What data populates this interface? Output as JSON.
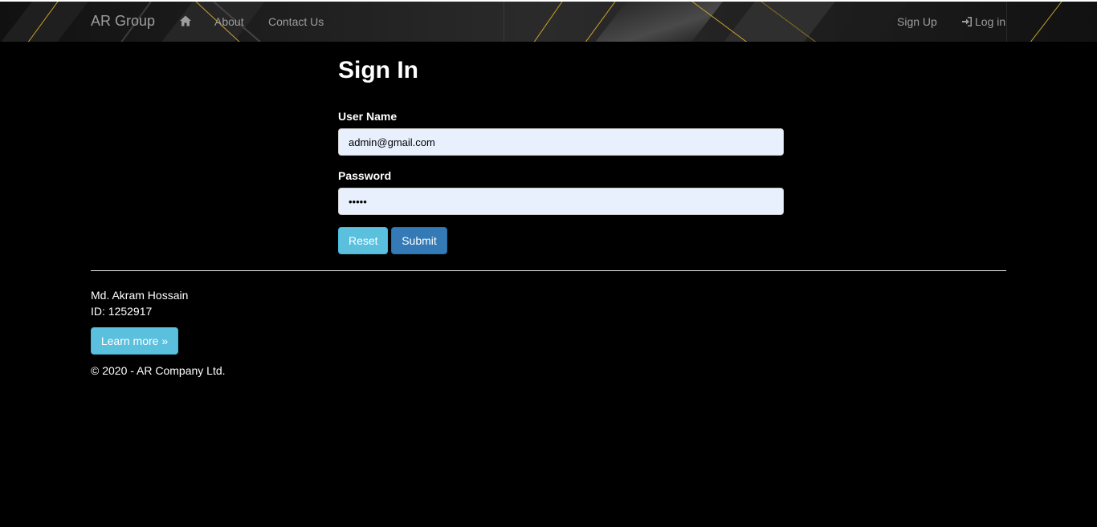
{
  "navbar": {
    "brand": "AR Group",
    "home_icon": "home-icon",
    "links": [
      "About",
      "Contact Us"
    ],
    "signup": "Sign Up",
    "login": "Log in",
    "login_icon": "log-in-icon"
  },
  "signin": {
    "title": "Sign In",
    "username_label": "User Name",
    "username_value": "admin@gmail.com",
    "password_label": "Password",
    "password_value": "admin",
    "reset_label": "Reset",
    "submit_label": "Submit"
  },
  "footer": {
    "name": "Md. Akram Hossain",
    "id": "ID: 1252917",
    "learn_more": "Learn more »",
    "copyright": "© 2020 - AR Company Ltd."
  },
  "colors": {
    "background": "#000000",
    "navbar": "#1a1a1a",
    "nav_text": "#9d9d9d",
    "accent_gold": "#c9a227",
    "info_button": "#5bc0de",
    "primary_button": "#337ab7",
    "input_fill": "#e8f0fe"
  }
}
